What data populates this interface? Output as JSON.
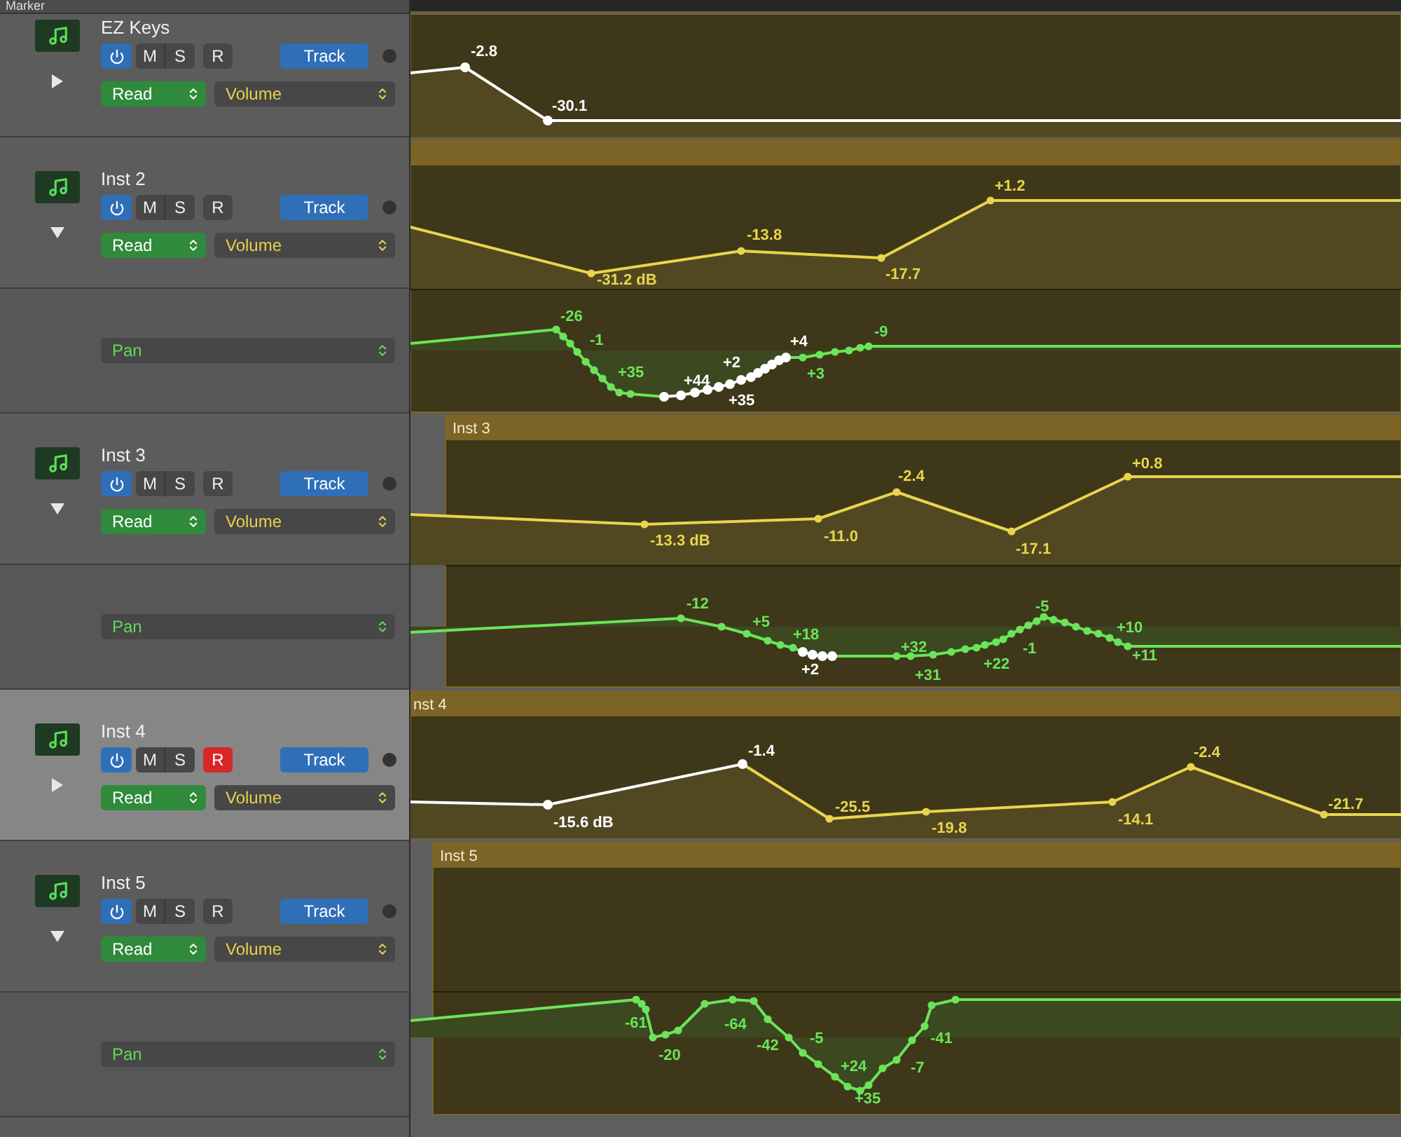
{
  "header": {
    "label": "Marker"
  },
  "tracks": [
    {
      "name": "EZ Keys",
      "selected": false,
      "expanded": false,
      "power_on": true,
      "mute": "M",
      "solo": "S",
      "record": "R",
      "record_armed": false,
      "group": "Track",
      "mode": "Read",
      "parameter": "Volume",
      "volume": {
        "labels": [
          {
            "text": "-2.8",
            "selected": true
          },
          {
            "text": "-30.1",
            "selected": true
          }
        ]
      }
    },
    {
      "name": "Inst 2",
      "selected": false,
      "expanded": true,
      "power_on": true,
      "mute": "M",
      "solo": "S",
      "record": "R",
      "record_armed": false,
      "group": "Track",
      "mode": "Read",
      "parameter": "Volume",
      "volume": {
        "labels": [
          {
            "text": "-31.2 dB",
            "selected": false
          },
          {
            "text": "-13.8",
            "selected": false
          },
          {
            "text": "-17.7",
            "selected": false
          },
          {
            "text": "+1.2",
            "selected": false
          }
        ]
      },
      "pan": {
        "parameter": "Pan",
        "labels": [
          {
            "text": "-26",
            "selected": false
          },
          {
            "text": "-1",
            "selected": false
          },
          {
            "text": "+35",
            "selected": false
          },
          {
            "text": "+44",
            "selected": true
          },
          {
            "text": "+2",
            "selected": true
          },
          {
            "text": "+4",
            "selected": true
          },
          {
            "text": "+35",
            "selected": true
          },
          {
            "text": "+3",
            "selected": false
          },
          {
            "text": "-9",
            "selected": false
          }
        ]
      }
    },
    {
      "name": "Inst 3",
      "selected": false,
      "expanded": true,
      "power_on": true,
      "mute": "M",
      "solo": "S",
      "record": "R",
      "record_armed": false,
      "group": "Track",
      "mode": "Read",
      "parameter": "Volume",
      "region_name": "Inst 3",
      "volume": {
        "labels": [
          {
            "text": "-13.3 dB",
            "selected": false
          },
          {
            "text": "-11.0",
            "selected": false
          },
          {
            "text": "-2.4",
            "selected": false
          },
          {
            "text": "-17.1",
            "selected": false
          },
          {
            "text": "+0.8",
            "selected": false
          }
        ]
      },
      "pan": {
        "parameter": "Pan",
        "labels": [
          {
            "text": "-12",
            "selected": false
          },
          {
            "text": "+5",
            "selected": false
          },
          {
            "text": "+18",
            "selected": false
          },
          {
            "text": "+2",
            "selected": true
          },
          {
            "text": "+32",
            "selected": false
          },
          {
            "text": "+31",
            "selected": false
          },
          {
            "text": "+22",
            "selected": false
          },
          {
            "text": "-1",
            "selected": false
          },
          {
            "text": "-5",
            "selected": false
          },
          {
            "text": "+10",
            "selected": false
          },
          {
            "text": "+11",
            "selected": false
          }
        ]
      }
    },
    {
      "name": "Inst 4",
      "selected": true,
      "expanded": false,
      "power_on": true,
      "mute": "M",
      "solo": "S",
      "record": "R",
      "record_armed": true,
      "group": "Track",
      "mode": "Read",
      "parameter": "Volume",
      "region_name": "nst 4",
      "volume": {
        "labels": [
          {
            "text": "-15.6 dB",
            "selected": true
          },
          {
            "text": "-1.4",
            "selected": true
          },
          {
            "text": "-25.5",
            "selected": false
          },
          {
            "text": "-19.8",
            "selected": false
          },
          {
            "text": "-14.1",
            "selected": false
          },
          {
            "text": "-2.4",
            "selected": false
          },
          {
            "text": "-21.7",
            "selected": false
          }
        ]
      }
    },
    {
      "name": "Inst 5",
      "selected": false,
      "expanded": true,
      "power_on": true,
      "mute": "M",
      "solo": "S",
      "record": "R",
      "record_armed": false,
      "group": "Track",
      "mode": "Read",
      "parameter": "Volume",
      "region_name": "Inst 5",
      "pan": {
        "parameter": "Pan",
        "labels": [
          {
            "text": "-61",
            "selected": false
          },
          {
            "text": "-20",
            "selected": false
          },
          {
            "text": "-64",
            "selected": false
          },
          {
            "text": "-42",
            "selected": false
          },
          {
            "text": "-5",
            "selected": false
          },
          {
            "text": "+24",
            "selected": false
          },
          {
            "text": "+35",
            "selected": false
          },
          {
            "text": "-7",
            "selected": false
          },
          {
            "text": "-41",
            "selected": false
          }
        ]
      }
    }
  ]
}
